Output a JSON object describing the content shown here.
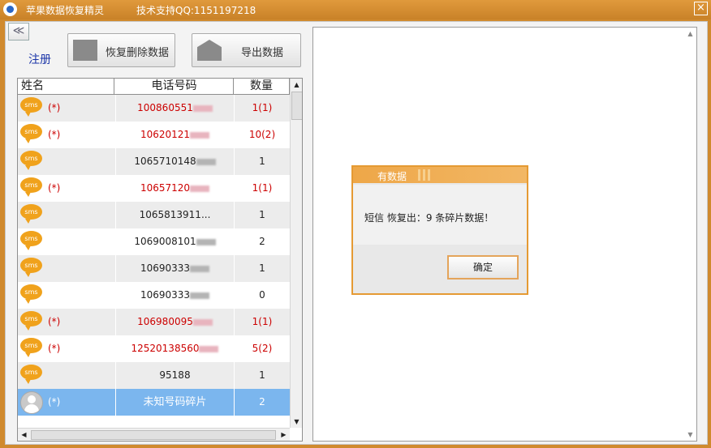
{
  "titlebar": {
    "title": "苹果数据恢复精灵",
    "support": "技术支持QQ:1151197218",
    "close": "×"
  },
  "toolbar": {
    "collapse": "≪",
    "register": "注册",
    "recover_label": "恢复删除数据",
    "export_label": "导出数据"
  },
  "table": {
    "headers": {
      "name": "姓名",
      "phone": "电话号码",
      "count": "数量"
    },
    "rows": [
      {
        "mark": "(*)",
        "phone": "100860551",
        "count": "1(1)",
        "red": true
      },
      {
        "mark": "(*)",
        "phone": "10620121",
        "count": "10(2)",
        "red": true
      },
      {
        "mark": "",
        "phone": "1065710148",
        "count": "1",
        "red": false
      },
      {
        "mark": "(*)",
        "phone": "10657120",
        "count": "1(1)",
        "red": true
      },
      {
        "mark": "",
        "phone": "1065813911...",
        "count": "1",
        "red": false
      },
      {
        "mark": "",
        "phone": "1069008101",
        "count": "2",
        "red": false
      },
      {
        "mark": "",
        "phone": "10690333",
        "count": "1",
        "red": false
      },
      {
        "mark": "",
        "phone": "10690333",
        "count": "0",
        "red": false
      },
      {
        "mark": "(*)",
        "phone": "106980095",
        "count": "1(1)",
        "red": true
      },
      {
        "mark": "(*)",
        "phone": "12520138560",
        "count": "5(2)",
        "red": true
      },
      {
        "mark": "",
        "phone": "95188",
        "count": "1",
        "red": false
      }
    ],
    "selected_row": {
      "mark": "(*)",
      "phone": "未知号码碎片",
      "count": "2"
    },
    "icon": "sms-icon"
  },
  "dialog": {
    "title": "有数据",
    "message": "短信 恢复出：9 条碎片数据！",
    "ok": "确定"
  },
  "colors": {
    "window": "#d08a2e",
    "selection": "#7bb6ee",
    "accent_red": "#cc0000",
    "dialog_border": "#e59a33"
  }
}
